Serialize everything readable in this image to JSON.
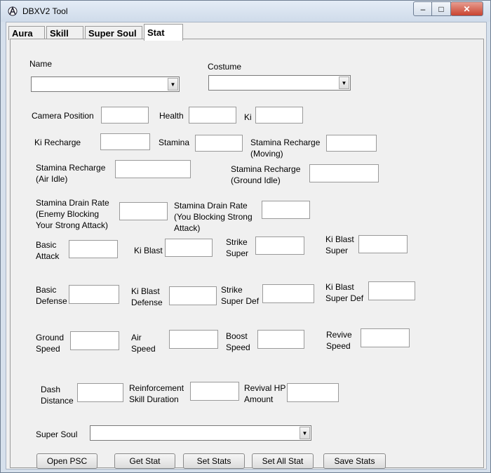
{
  "window": {
    "title": "DBXV2 Tool",
    "minimize_label": "–",
    "maximize_label": "□",
    "close_label": "✕"
  },
  "tabs": [
    {
      "label": "Aura"
    },
    {
      "label": "Skill"
    },
    {
      "label": "Super Soul"
    },
    {
      "label": "Stat",
      "active": true
    }
  ],
  "form": {
    "name_label": "Name",
    "name_value": "",
    "costume_label": "Costume",
    "costume_value": "",
    "fields": {
      "camera_position": {
        "label": "Camera Position",
        "value": ""
      },
      "health": {
        "label": "Health",
        "value": ""
      },
      "ki": {
        "label": "Ki",
        "value": ""
      },
      "ki_recharge": {
        "label": "Ki Recharge",
        "value": ""
      },
      "stamina": {
        "label": "Stamina",
        "value": ""
      },
      "stamina_recharge_moving": {
        "label": "Stamina Recharge\n(Moving)",
        "value": ""
      },
      "stamina_recharge_air_idle": {
        "label": "Stamina Recharge\n(Air Idle)",
        "value": ""
      },
      "stamina_recharge_ground_idle": {
        "label": "Stamina Recharge\n(Ground Idle)",
        "value": ""
      },
      "stamina_drain_enemy_blocking": {
        "label": "Stamina Drain Rate\n(Enemy Blocking\nYour Strong Attack)",
        "value": ""
      },
      "stamina_drain_you_blocking": {
        "label": "Stamina Drain Rate\n(You Blocking Strong\nAttack)",
        "value": ""
      },
      "basic_attack": {
        "label": "Basic\nAttack",
        "value": ""
      },
      "ki_blast": {
        "label": "Ki Blast",
        "value": ""
      },
      "strike_super": {
        "label": "Strike\nSuper",
        "value": ""
      },
      "ki_blast_super": {
        "label": "Ki Blast\nSuper",
        "value": ""
      },
      "basic_defense": {
        "label": "Basic\nDefense",
        "value": ""
      },
      "ki_blast_defense": {
        "label": "Ki Blast\nDefense",
        "value": ""
      },
      "strike_super_def": {
        "label": "Strike\nSuper Def",
        "value": ""
      },
      "ki_blast_super_def": {
        "label": "Ki Blast\nSuper Def",
        "value": ""
      },
      "ground_speed": {
        "label": "Ground\nSpeed",
        "value": ""
      },
      "air_speed": {
        "label": "Air\nSpeed",
        "value": ""
      },
      "boost_speed": {
        "label": "Boost\nSpeed",
        "value": ""
      },
      "revive_speed": {
        "label": "Revive\nSpeed",
        "value": ""
      },
      "dash_distance": {
        "label": "Dash\nDistance",
        "value": ""
      },
      "reinforcement_skill_duration": {
        "label": "Reinforcement\nSkill Duration",
        "value": ""
      },
      "revival_hp_amount": {
        "label": "Revival HP\nAmount",
        "value": ""
      }
    },
    "super_soul_label": "Super Soul",
    "super_soul_value": ""
  },
  "buttons": {
    "open_psc": "Open PSC",
    "get_stat": "Get Stat",
    "set_stats": "Set Stats",
    "set_all_stat": "Set All Stat",
    "save_stats": "Save Stats"
  },
  "icons": {
    "app": "gear-figure-icon",
    "dropdown": "chevron-down-icon"
  }
}
